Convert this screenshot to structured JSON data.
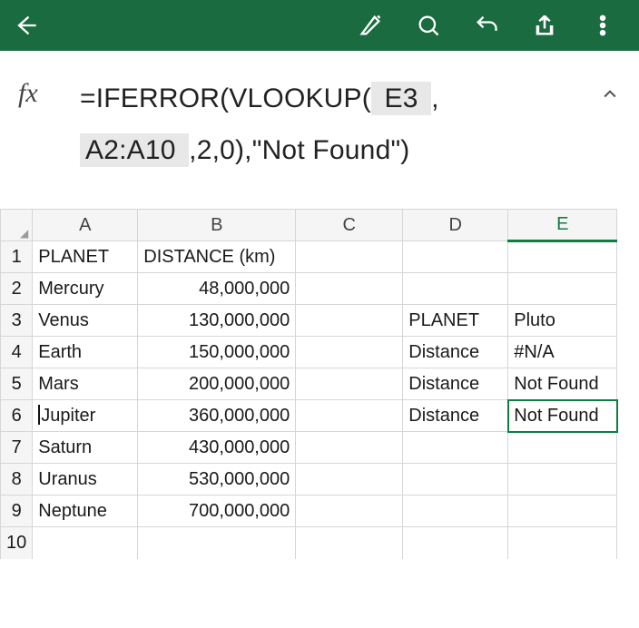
{
  "toolbar": {
    "back": "Back",
    "pen": "Draw",
    "search": "Find",
    "undo": "Undo",
    "share": "Share",
    "more": "More"
  },
  "formula": {
    "fx": "fx",
    "part1": "=IFERROR(VLOOKUP(",
    "ref1": " E3 ",
    "part2": ",",
    "ref2": " A2:A10 ",
    "part3": ",2,0),\"Not Found\")"
  },
  "cols": [
    "A",
    "B",
    "C",
    "D",
    "E"
  ],
  "rows": [
    "1",
    "2",
    "3",
    "4",
    "5",
    "6",
    "7",
    "8",
    "9",
    "10"
  ],
  "cells": {
    "A1": "PLANET",
    "B1": "DISTANCE (km)",
    "A2": "Mercury",
    "B2": "48,000,000",
    "A3": "Venus",
    "B3": "130,000,000",
    "D3": "PLANET",
    "E3": "Pluto",
    "A4": "Earth",
    "B4": "150,000,000",
    "D4": "Distance",
    "E4": "#N/A",
    "A5": "Mars",
    "B5": "200,000,000",
    "D5": "Distance",
    "E5": "Not Found",
    "A6": "Jupiter",
    "B6": "360,000,000",
    "D6": "Distance",
    "E6": "Not Found",
    "A7": "Saturn",
    "B7": "430,000,000",
    "A8": "Uranus",
    "B8": "530,000,000",
    "A9": "Neptune",
    "B9": "700,000,000"
  },
  "chart_data": {
    "type": "table",
    "columns": [
      "PLANET",
      "DISTANCE (km)"
    ],
    "rows": [
      [
        "Mercury",
        48000000
      ],
      [
        "Venus",
        130000000
      ],
      [
        "Earth",
        150000000
      ],
      [
        "Mars",
        200000000
      ],
      [
        "Jupiter",
        360000000
      ],
      [
        "Saturn",
        430000000
      ],
      [
        "Uranus",
        530000000
      ],
      [
        "Neptune",
        700000000
      ]
    ],
    "lookup": {
      "PLANET": "Pluto",
      "results": [
        "#N/A",
        "Not Found",
        "Not Found"
      ]
    }
  }
}
